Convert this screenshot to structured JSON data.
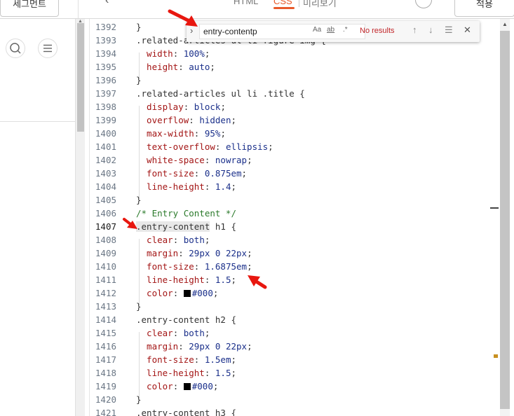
{
  "topbar": {
    "left_button": "세그먼트",
    "tabs": [
      {
        "label": "HTML",
        "active": false
      },
      {
        "label": "CSS",
        "active": true
      },
      {
        "label": "미리보기",
        "active": false
      }
    ],
    "right_button": "적용",
    "accent": "#e85a2b"
  },
  "find": {
    "value": "entry-contentp",
    "match_case": "Aa",
    "whole_word": "ab",
    "regex": ".*",
    "status": "No results"
  },
  "code_lines": [
    {
      "n": "1392",
      "parts": [
        [
          "punc",
          "}"
        ]
      ]
    },
    {
      "n": "1393",
      "parts": [
        [
          "sel",
          ".related-articles ul li figure img {"
        ]
      ]
    },
    {
      "n": "1394",
      "parts": [
        [
          "prop",
          "  width"
        ],
        [
          "punc",
          ": "
        ],
        [
          "val",
          "100%"
        ],
        [
          "punc",
          ";"
        ]
      ]
    },
    {
      "n": "1395",
      "parts": [
        [
          "prop",
          "  height"
        ],
        [
          "punc",
          ": "
        ],
        [
          "val",
          "auto"
        ],
        [
          "punc",
          ";"
        ]
      ]
    },
    {
      "n": "1396",
      "parts": [
        [
          "punc",
          "}"
        ]
      ]
    },
    {
      "n": "1397",
      "parts": [
        [
          "sel",
          ".related-articles ul li .title {"
        ]
      ]
    },
    {
      "n": "1398",
      "parts": [
        [
          "prop",
          "  display"
        ],
        [
          "punc",
          ": "
        ],
        [
          "val",
          "block"
        ],
        [
          "punc",
          ";"
        ]
      ]
    },
    {
      "n": "1399",
      "parts": [
        [
          "prop",
          "  overflow"
        ],
        [
          "punc",
          ": "
        ],
        [
          "val",
          "hidden"
        ],
        [
          "punc",
          ";"
        ]
      ]
    },
    {
      "n": "1400",
      "parts": [
        [
          "prop",
          "  max-width"
        ],
        [
          "punc",
          ": "
        ],
        [
          "val",
          "95%"
        ],
        [
          "punc",
          ";"
        ]
      ]
    },
    {
      "n": "1401",
      "parts": [
        [
          "prop",
          "  text-overflow"
        ],
        [
          "punc",
          ": "
        ],
        [
          "val",
          "ellipsis"
        ],
        [
          "punc",
          ";"
        ]
      ]
    },
    {
      "n": "1402",
      "parts": [
        [
          "prop",
          "  white-space"
        ],
        [
          "punc",
          ": "
        ],
        [
          "val",
          "nowrap"
        ],
        [
          "punc",
          ";"
        ]
      ]
    },
    {
      "n": "1403",
      "parts": [
        [
          "prop",
          "  font-size"
        ],
        [
          "punc",
          ": "
        ],
        [
          "val",
          "0.875em"
        ],
        [
          "punc",
          ";"
        ]
      ]
    },
    {
      "n": "1404",
      "parts": [
        [
          "prop",
          "  line-height"
        ],
        [
          "punc",
          ": "
        ],
        [
          "val",
          "1.4"
        ],
        [
          "punc",
          ";"
        ]
      ]
    },
    {
      "n": "1405",
      "parts": [
        [
          "punc",
          "}"
        ]
      ]
    },
    {
      "n": "1406",
      "parts": [
        [
          "comment",
          "/* Entry Content */"
        ]
      ]
    },
    {
      "n": "1407",
      "parts": [
        [
          "hl",
          ".entry-content"
        ],
        [
          "sel",
          " h1 {"
        ]
      ],
      "active": true
    },
    {
      "n": "1408",
      "parts": [
        [
          "prop",
          "  clear"
        ],
        [
          "punc",
          ": "
        ],
        [
          "val",
          "both"
        ],
        [
          "punc",
          ";"
        ]
      ]
    },
    {
      "n": "1409",
      "parts": [
        [
          "prop",
          "  margin"
        ],
        [
          "punc",
          ": "
        ],
        [
          "val",
          "29px 0 22px"
        ],
        [
          "punc",
          ";"
        ]
      ]
    },
    {
      "n": "1410",
      "parts": [
        [
          "prop",
          "  font-size"
        ],
        [
          "punc",
          ": "
        ],
        [
          "val",
          "1.6875em"
        ],
        [
          "punc",
          ";"
        ]
      ]
    },
    {
      "n": "1411",
      "parts": [
        [
          "prop",
          "  line-height"
        ],
        [
          "punc",
          ": "
        ],
        [
          "val",
          "1.5"
        ],
        [
          "punc",
          ";"
        ]
      ]
    },
    {
      "n": "1412",
      "parts": [
        [
          "prop",
          "  color"
        ],
        [
          "punc",
          ": "
        ],
        [
          "swatch",
          ""
        ],
        [
          "val",
          "#000"
        ],
        [
          "punc",
          ";"
        ]
      ]
    },
    {
      "n": "1413",
      "parts": [
        [
          "punc",
          "}"
        ]
      ]
    },
    {
      "n": "1414",
      "parts": [
        [
          "sel",
          ".entry-content h2 {"
        ]
      ]
    },
    {
      "n": "1415",
      "parts": [
        [
          "prop",
          "  clear"
        ],
        [
          "punc",
          ": "
        ],
        [
          "val",
          "both"
        ],
        [
          "punc",
          ";"
        ]
      ]
    },
    {
      "n": "1416",
      "parts": [
        [
          "prop",
          "  margin"
        ],
        [
          "punc",
          ": "
        ],
        [
          "val",
          "29px 0 22px"
        ],
        [
          "punc",
          ";"
        ]
      ]
    },
    {
      "n": "1417",
      "parts": [
        [
          "prop",
          "  font-size"
        ],
        [
          "punc",
          ": "
        ],
        [
          "val",
          "1.5em"
        ],
        [
          "punc",
          ";"
        ]
      ]
    },
    {
      "n": "1418",
      "parts": [
        [
          "prop",
          "  line-height"
        ],
        [
          "punc",
          ": "
        ],
        [
          "val",
          "1.5"
        ],
        [
          "punc",
          ";"
        ]
      ]
    },
    {
      "n": "1419",
      "parts": [
        [
          "prop",
          "  color"
        ],
        [
          "punc",
          ": "
        ],
        [
          "swatch",
          ""
        ],
        [
          "val",
          "#000"
        ],
        [
          "punc",
          ";"
        ]
      ]
    },
    {
      "n": "1420",
      "parts": [
        [
          "punc",
          "}"
        ]
      ]
    },
    {
      "n": "1421",
      "parts": [
        [
          "sel",
          ".entry-content h3 {"
        ]
      ]
    }
  ],
  "colors": {
    "property": "#a31515",
    "value": "#1a2f8a",
    "comment": "#2b7a2b",
    "no_results": "#c2262a",
    "annotation_arrow": "#e8170f"
  }
}
